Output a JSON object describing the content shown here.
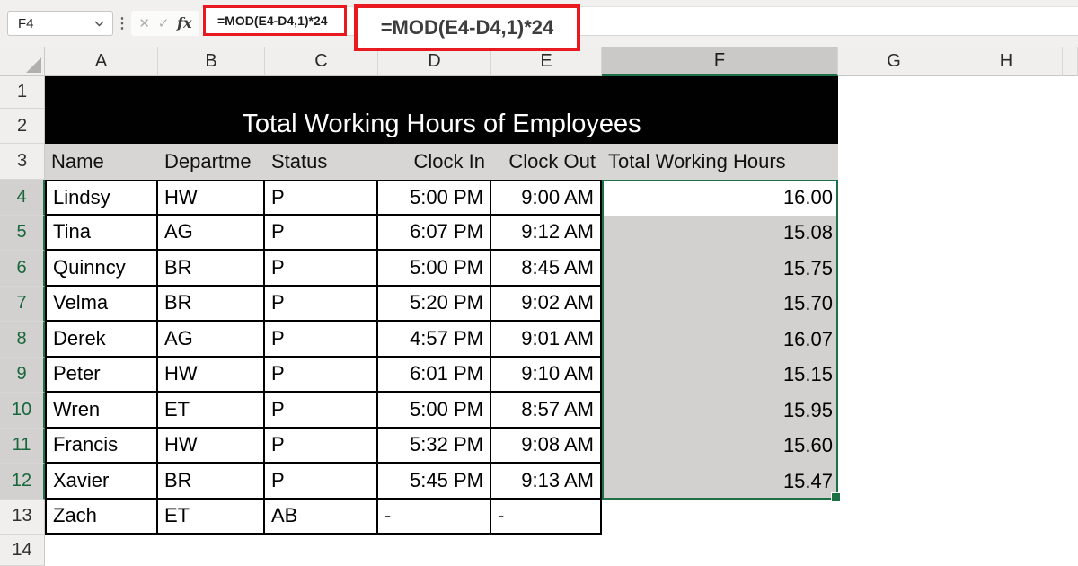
{
  "toolbar": {
    "name_box_value": "F4",
    "formula": "=MOD(E4-D4,1)*24",
    "cancel_icon": "✕",
    "confirm_icon": "✓",
    "function_icon": "fx"
  },
  "annotation": {
    "formula_callout": "=MOD(E4-D4,1)*24"
  },
  "sheet": {
    "title": "Total Working Hours of Employees",
    "column_headers": [
      "A",
      "B",
      "C",
      "D",
      "E",
      "F",
      "G",
      "H"
    ],
    "selected_column": "F",
    "row_count": 14,
    "selected_row_start": 4,
    "selected_row_end": 12,
    "table_headers": {
      "name": "Name",
      "department": "Departme",
      "status": "Status",
      "clock_in": "Clock In",
      "clock_out": "Clock Out",
      "total": "Total Working Hours"
    },
    "rows": [
      {
        "row": 4,
        "name": "Lindsy",
        "department": "HW",
        "status": "P",
        "clock_in": "5:00 PM",
        "clock_out": "9:00 AM",
        "total": "16.00"
      },
      {
        "row": 5,
        "name": "Tina",
        "department": "AG",
        "status": "P",
        "clock_in": "6:07 PM",
        "clock_out": "9:12 AM",
        "total": "15.08"
      },
      {
        "row": 6,
        "name": "Quinncy",
        "department": "BR",
        "status": "P",
        "clock_in": "5:00 PM",
        "clock_out": "8:45 AM",
        "total": "15.75"
      },
      {
        "row": 7,
        "name": "Velma",
        "department": "BR",
        "status": "P",
        "clock_in": "5:20 PM",
        "clock_out": "9:02 AM",
        "total": "15.70"
      },
      {
        "row": 8,
        "name": "Derek",
        "department": "AG",
        "status": "P",
        "clock_in": "4:57 PM",
        "clock_out": "9:01 AM",
        "total": "16.07"
      },
      {
        "row": 9,
        "name": "Peter",
        "department": "HW",
        "status": "P",
        "clock_in": "6:01 PM",
        "clock_out": "9:10 AM",
        "total": "15.15"
      },
      {
        "row": 10,
        "name": "Wren",
        "department": "ET",
        "status": "P",
        "clock_in": "5:00 PM",
        "clock_out": "8:57 AM",
        "total": "15.95"
      },
      {
        "row": 11,
        "name": "Francis",
        "department": "HW",
        "status": "P",
        "clock_in": "5:32 PM",
        "clock_out": "9:08 AM",
        "total": "15.60"
      },
      {
        "row": 12,
        "name": "Xavier",
        "department": "BR",
        "status": "P",
        "clock_in": "5:45 PM",
        "clock_out": "9:13 AM",
        "total": "15.47"
      },
      {
        "row": 13,
        "name": "Zach",
        "department": "ET",
        "status": "AB",
        "clock_in": "-",
        "clock_out": "-",
        "total": ""
      }
    ]
  },
  "colors": {
    "selection_green": "#1e7145",
    "annotation_red": "#e8191f",
    "selection_fill": "#d3d1d0",
    "table_header_fill": "#d8d6d5",
    "banner_bg": "#010101"
  }
}
